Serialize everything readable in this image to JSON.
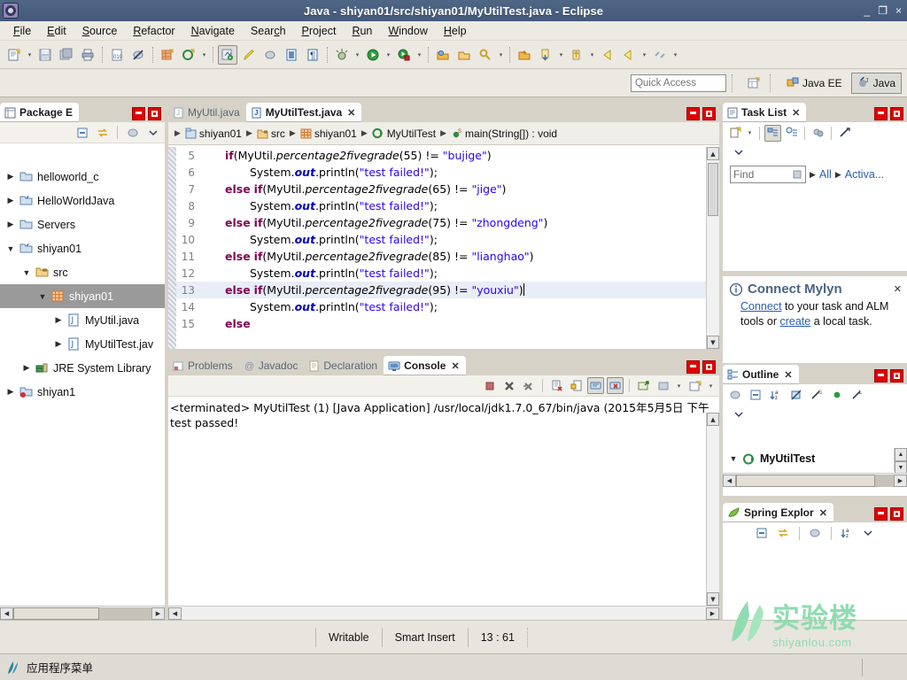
{
  "window": {
    "title": "Java - shiyan01/src/shiyan01/MyUtilTest.java - Eclipse",
    "minimize": "_",
    "restore": "❐",
    "close": "×",
    "titlebar_color": "#4f6685"
  },
  "menubar": [
    {
      "label": "File",
      "mnemonic": "F"
    },
    {
      "label": "Edit",
      "mnemonic": "E"
    },
    {
      "label": "Source",
      "mnemonic": "S"
    },
    {
      "label": "Refactor",
      "mnemonic": "R"
    },
    {
      "label": "Navigate",
      "mnemonic": "N"
    },
    {
      "label": "Search",
      "mnemonic": "c"
    },
    {
      "label": "Project",
      "mnemonic": "P"
    },
    {
      "label": "Run",
      "mnemonic": "R"
    },
    {
      "label": "Window",
      "mnemonic": "W"
    },
    {
      "label": "Help",
      "mnemonic": "H"
    }
  ],
  "toolbar": {
    "items": [
      "new-wizard-icon",
      "new-dropdown-arrow",
      "save-icon",
      "save-all-icon",
      "print-icon",
      "separator",
      "toggle-breakpoint-icon",
      "skip-breakpoints-icon",
      "separator",
      "new-java-package-icon",
      "new-java-class-icon",
      "new-class-dropdown-arrow",
      "separator",
      "open-type-icon",
      "annotate-icon",
      "build-icon",
      "externalize-strings-icon",
      "mark-occurrences-icon",
      "separator",
      "debug-icon",
      "debug-dropdown-arrow",
      "run-icon",
      "run-dropdown-arrow",
      "run-external-tools-icon",
      "external-tools-dropdown-arrow",
      "separator",
      "open-search-icon",
      "open-task-icon",
      "search-icon",
      "search-dropdown-arrow",
      "separator",
      "previous-annotation-icon",
      "next-annotation-icon",
      "next-dropdown-arrow",
      "last-edit-location-icon",
      "back-icon",
      "forward-icon",
      "forward-dropdown-arrow",
      "link-icon",
      "link-dropdown-arrow"
    ]
  },
  "quick_access": {
    "placeholder": "Quick Access",
    "open_perspective_icon": "open-perspective-icon",
    "perspectives": [
      {
        "label": "Java EE",
        "icon": "java-ee-perspective-icon",
        "active": false
      },
      {
        "label": "Java",
        "icon": "java-perspective-icon",
        "active": true
      }
    ]
  },
  "package_explorer": {
    "tab_label": "Package E",
    "toolbar": [
      "collapse-all-icon",
      "link-with-editor-icon",
      "view-menu-filter-icon",
      "view-menu-icon"
    ],
    "minimize_icon": "minimize-icon",
    "maximize_icon": "maximize-icon",
    "tree": [
      {
        "label": "helloworld_c",
        "indent": 0,
        "twisty": "collapsed",
        "icon": "project-folder-icon",
        "selected": false
      },
      {
        "label": "HelloWorldJava",
        "indent": 0,
        "twisty": "collapsed",
        "icon": "java-project-icon",
        "selected": false
      },
      {
        "label": "Servers",
        "indent": 0,
        "twisty": "collapsed",
        "icon": "project-folder-icon",
        "selected": false
      },
      {
        "label": "shiyan01",
        "indent": 0,
        "twisty": "expanded",
        "icon": "java-project-icon",
        "selected": false
      },
      {
        "label": "src",
        "indent": 1,
        "twisty": "expanded",
        "icon": "source-folder-icon",
        "selected": false
      },
      {
        "label": "shiyan01",
        "indent": 2,
        "twisty": "expanded",
        "icon": "package-icon",
        "selected": true
      },
      {
        "label": "MyUtil.java",
        "indent": 3,
        "twisty": "collapsed",
        "icon": "java-file-icon",
        "selected": false
      },
      {
        "label": "MyUtilTest.jav",
        "indent": 3,
        "twisty": "collapsed",
        "icon": "java-file-icon",
        "selected": false
      },
      {
        "label": "JRE System Library",
        "indent": 1,
        "twisty": "collapsed",
        "icon": "jre-library-icon",
        "selected": false
      },
      {
        "label": "shiyan1",
        "indent": 0,
        "twisty": "collapsed",
        "icon": "java-project-error-icon",
        "selected": false
      }
    ]
  },
  "editor": {
    "tabs": [
      {
        "label": "MyUtil.java",
        "icon": "java-file-icon",
        "active": false,
        "closeable": false
      },
      {
        "label": "MyUtilTest.java",
        "icon": "java-file-icon",
        "active": true,
        "closeable": true
      }
    ],
    "close_glyph": "✕",
    "breadcrumb": [
      {
        "label": "shiyan01",
        "icon": "java-project-icon"
      },
      {
        "label": "src",
        "icon": "source-folder-icon"
      },
      {
        "label": "shiyan01",
        "icon": "package-icon"
      },
      {
        "label": "MyUtilTest",
        "icon": "class-icon"
      },
      {
        "label": "main(String[]) : void",
        "icon": "method-static-icon"
      }
    ],
    "lines": [
      {
        "num": "5",
        "highlight": false,
        "indent": 4,
        "tokens": [
          {
            "t": "if",
            "c": "kw"
          },
          {
            "t": "(MyUtil.",
            "c": ""
          },
          {
            "t": "percentage2fivegrade",
            "c": "mth"
          },
          {
            "t": "(55) != ",
            "c": ""
          },
          {
            "t": "\"bujige\"",
            "c": "str"
          },
          {
            "t": ")",
            "c": ""
          }
        ]
      },
      {
        "num": "6",
        "highlight": false,
        "indent": 8,
        "tokens": [
          {
            "t": "System.",
            "c": ""
          },
          {
            "t": "out",
            "c": "fld"
          },
          {
            "t": ".println(",
            "c": ""
          },
          {
            "t": "\"test failed!\"",
            "c": "str"
          },
          {
            "t": ");",
            "c": ""
          }
        ]
      },
      {
        "num": "7",
        "highlight": false,
        "indent": 4,
        "tokens": [
          {
            "t": "else",
            "c": "kw"
          },
          {
            "t": " ",
            "c": ""
          },
          {
            "t": "if",
            "c": "kw"
          },
          {
            "t": "(MyUtil.",
            "c": ""
          },
          {
            "t": "percentage2fivegrade",
            "c": "mth"
          },
          {
            "t": "(65) != ",
            "c": ""
          },
          {
            "t": "\"jige\"",
            "c": "str"
          },
          {
            "t": ")",
            "c": ""
          }
        ]
      },
      {
        "num": "8",
        "highlight": false,
        "indent": 8,
        "tokens": [
          {
            "t": "System.",
            "c": ""
          },
          {
            "t": "out",
            "c": "fld"
          },
          {
            "t": ".println(",
            "c": ""
          },
          {
            "t": "\"test failed!\"",
            "c": "str"
          },
          {
            "t": ");",
            "c": ""
          }
        ]
      },
      {
        "num": "9",
        "highlight": false,
        "indent": 4,
        "tokens": [
          {
            "t": "else",
            "c": "kw"
          },
          {
            "t": " ",
            "c": ""
          },
          {
            "t": "if",
            "c": "kw"
          },
          {
            "t": "(MyUtil.",
            "c": ""
          },
          {
            "t": "percentage2fivegrade",
            "c": "mth"
          },
          {
            "t": "(75) != ",
            "c": ""
          },
          {
            "t": "\"zhongdeng\"",
            "c": "str"
          },
          {
            "t": ")",
            "c": ""
          }
        ]
      },
      {
        "num": "10",
        "highlight": false,
        "indent": 8,
        "tokens": [
          {
            "t": "System.",
            "c": ""
          },
          {
            "t": "out",
            "c": "fld"
          },
          {
            "t": ".println(",
            "c": ""
          },
          {
            "t": "\"test failed!\"",
            "c": "str"
          },
          {
            "t": ");",
            "c": ""
          }
        ]
      },
      {
        "num": "11",
        "highlight": false,
        "indent": 4,
        "tokens": [
          {
            "t": "else",
            "c": "kw"
          },
          {
            "t": " ",
            "c": ""
          },
          {
            "t": "if",
            "c": "kw"
          },
          {
            "t": "(MyUtil.",
            "c": ""
          },
          {
            "t": "percentage2fivegrade",
            "c": "mth"
          },
          {
            "t": "(85) != ",
            "c": ""
          },
          {
            "t": "\"lianghao\"",
            "c": "str"
          },
          {
            "t": ")",
            "c": ""
          }
        ]
      },
      {
        "num": "12",
        "highlight": false,
        "indent": 8,
        "tokens": [
          {
            "t": "System.",
            "c": ""
          },
          {
            "t": "out",
            "c": "fld"
          },
          {
            "t": ".println(",
            "c": ""
          },
          {
            "t": "\"test failed!\"",
            "c": "str"
          },
          {
            "t": ");",
            "c": ""
          }
        ]
      },
      {
        "num": "13",
        "highlight": true,
        "indent": 4,
        "caret": true,
        "tokens": [
          {
            "t": "else",
            "c": "kw"
          },
          {
            "t": " ",
            "c": ""
          },
          {
            "t": "if",
            "c": "kw"
          },
          {
            "t": "(MyUtil.",
            "c": ""
          },
          {
            "t": "percentage2fivegrade",
            "c": "mth"
          },
          {
            "t": "(95) != ",
            "c": ""
          },
          {
            "t": "\"youxiu\"",
            "c": "str"
          },
          {
            "t": ")",
            "c": ""
          }
        ]
      },
      {
        "num": "14",
        "highlight": false,
        "indent": 8,
        "tokens": [
          {
            "t": "System.",
            "c": ""
          },
          {
            "t": "out",
            "c": "fld"
          },
          {
            "t": ".println(",
            "c": ""
          },
          {
            "t": "\"test failed!\"",
            "c": "str"
          },
          {
            "t": ");",
            "c": ""
          }
        ]
      },
      {
        "num": "15",
        "highlight": false,
        "indent": 4,
        "tokens": [
          {
            "t": "else",
            "c": "kw"
          }
        ]
      }
    ]
  },
  "bottom_panel": {
    "tabs": [
      {
        "label": "Problems",
        "icon": "problems-icon",
        "active": false
      },
      {
        "label": "Javadoc",
        "icon": "javadoc-icon",
        "active": false
      },
      {
        "label": "Declaration",
        "icon": "declaration-icon",
        "active": false
      },
      {
        "label": "Console",
        "icon": "console-icon",
        "active": true
      }
    ],
    "close_glyph": "✕",
    "toolbar": [
      "terminate-icon",
      "remove-launch-icon",
      "remove-all-terminated-icon",
      "separator",
      "clear-console-icon",
      "scroll-lock-icon",
      "show-console-on-output-icon",
      "show-console-on-error-icon",
      "separator",
      "pin-console-icon",
      "display-selected-console-icon",
      "display-console-dropdown-arrow",
      "open-console-icon",
      "open-console-dropdown-arrow"
    ],
    "console": {
      "header": "<terminated> MyUtilTest (1) [Java Application] /usr/local/jdk1.7.0_67/bin/java (2015年5月5日 下午",
      "output": "test passed!"
    }
  },
  "task_list": {
    "tab_label": "Task List",
    "close_glyph": "✕",
    "toolbar": [
      "new-task-icon",
      "new-task-dropdown-arrow",
      "categorized-mode-icon",
      "scheduled-mode-icon",
      "synchronize-icon",
      "focus-on-workweek-icon",
      "view-menu-icon"
    ],
    "find_placeholder": "Find",
    "filter_all": "All",
    "filter_activate": "Activa...",
    "minimize_icon": "minimize-icon",
    "maximize_icon": "maximize-icon"
  },
  "mylyn": {
    "title": "Connect Mylyn",
    "close_glyph": "✕",
    "info_icon": "info-icon",
    "link_connect": "Connect",
    "text_mid": " to your task and ALM tools or ",
    "link_create": "create",
    "text_end": " a local task."
  },
  "outline": {
    "tab_label": "Outline",
    "close_glyph": "✕",
    "toolbar": [
      "focus-on-active-task-icon",
      "collapse-all-icon",
      "sort-icon",
      "hide-fields-icon",
      "hide-static-icon",
      "hide-non-public-icon",
      "hide-local-types-icon"
    ],
    "items": [
      {
        "label": "MyUtilTest",
        "icon": "class-icon",
        "twisty": "expanded"
      }
    ],
    "minimize_icon": "minimize-icon",
    "maximize_icon": "maximize-icon"
  },
  "spring_explorer": {
    "tab_label": "Spring Explor",
    "close_glyph": "✕",
    "toolbar": [
      "collapse-all-icon",
      "link-with-editor-icon",
      "filter-icon",
      "sort-icon",
      "view-menu-icon"
    ],
    "minimize_icon": "minimize-icon",
    "maximize_icon": "maximize-icon"
  },
  "statusbar": {
    "writable": "Writable",
    "insert_mode": "Smart Insert",
    "position": "13 : 61"
  },
  "watermark": {
    "cn": "实验楼",
    "en": "shiyanlou.com",
    "color": "#8fdcb0"
  },
  "taskbar": {
    "app_menu": "应用程序菜单",
    "icon": "app-menu-icon"
  }
}
